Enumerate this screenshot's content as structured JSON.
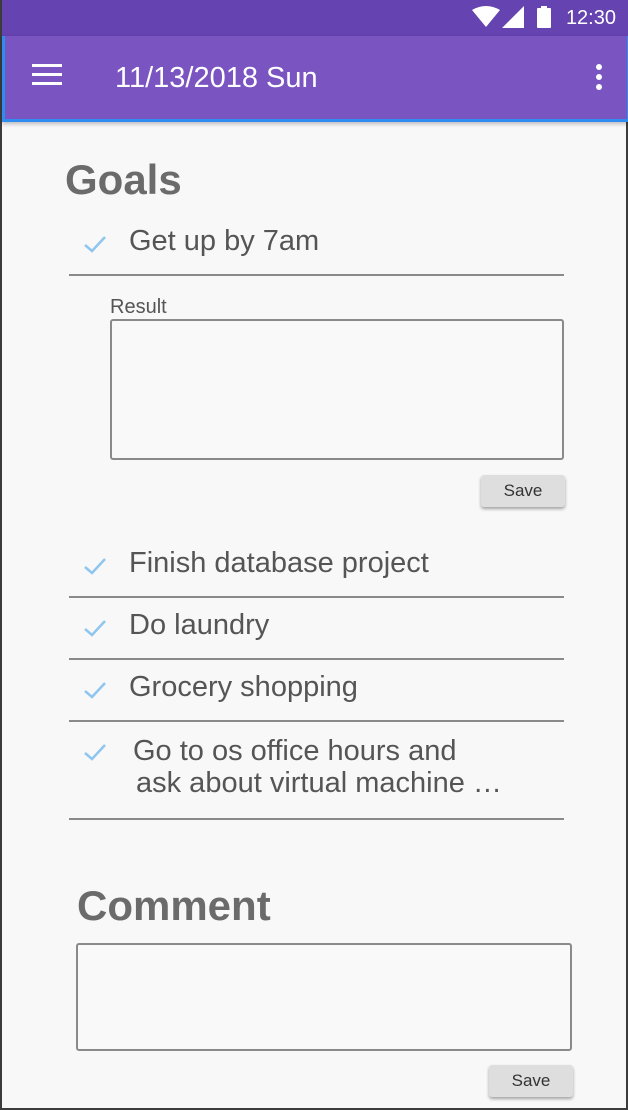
{
  "status_bar": {
    "time": "12:30",
    "icons": [
      "wifi-icon",
      "signal-icon",
      "battery-icon"
    ]
  },
  "app_bar": {
    "title": "11/13/2018 Sun",
    "menu_icon": "menu-icon",
    "more_icon": "more-vert-icon"
  },
  "goals": {
    "title": "Goals",
    "items": [
      {
        "label": "Get up by 7am"
      },
      {
        "label": "Finish database project"
      },
      {
        "label": "Do laundry"
      },
      {
        "label": "Grocery shopping"
      },
      {
        "label_line1": "Go to os office hours and",
        "label_line2": "ask about virtual machine …"
      }
    ],
    "result_label": "Result",
    "result_value": "",
    "save_label": "Save"
  },
  "comment": {
    "title": "Comment",
    "value": "",
    "save_label": "Save"
  },
  "colors": {
    "status_bar": "#6543b1",
    "app_bar": "#7a54c0",
    "app_bar_border": "#2f8cf0",
    "check": "#8ec6ef",
    "heading": "#6b6b6b"
  }
}
